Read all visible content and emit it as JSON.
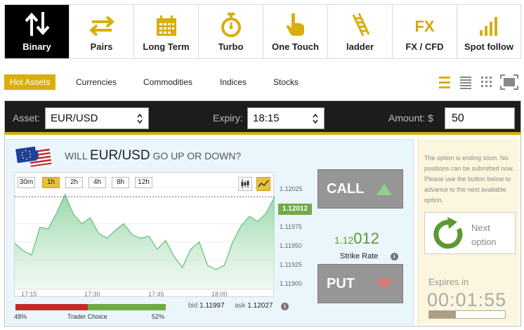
{
  "tabs": [
    {
      "label": "Binary",
      "icon": "up-down-arrows-icon",
      "active": true
    },
    {
      "label": "Pairs",
      "icon": "left-right-arrows-icon"
    },
    {
      "label": "Long Term",
      "icon": "calendar-icon"
    },
    {
      "label": "Turbo",
      "icon": "stopwatch-icon"
    },
    {
      "label": "One Touch",
      "icon": "pointing-hand-icon"
    },
    {
      "label": "ladder",
      "icon": "ladder-icon"
    },
    {
      "label": "FX / CFD",
      "icon": "fx-icon",
      "icon_text": "FX"
    },
    {
      "label": "Spot follow",
      "icon": "bar-chart-icon"
    }
  ],
  "categories": {
    "hot": "Hot Assets",
    "items": [
      "Currencies",
      "Commodities",
      "Indices",
      "Stocks"
    ]
  },
  "view_icons": [
    "list-view-icon",
    "compact-list-icon",
    "grid-view-icon",
    "fullscreen-icon"
  ],
  "trade": {
    "asset_label": "Asset:",
    "asset": "EUR/USD",
    "expiry_label": "Expiry:",
    "expiry": "18:15",
    "amount_label": "Amount: $",
    "amount": "50",
    "question_pre": "WILL",
    "question_asset": "EUR/USD",
    "question_post": "GO UP OR DOWN?",
    "call": "CALL",
    "put": "PUT",
    "strike_prefix": "1.12",
    "strike_main": "012",
    "strike_label": "Strike Rate"
  },
  "chart": {
    "timeframes": [
      "30m",
      "1h",
      "2h",
      "4h",
      "8h",
      "12h"
    ],
    "active_timeframe": "1h",
    "chart_types": [
      "candlestick-icon",
      "line-chart-icon"
    ],
    "active_chart_type": "line-chart-icon",
    "current_price": "1.12012",
    "y_ticks": [
      "1.12025",
      "1.11975",
      "1.11950",
      "1.11925",
      "1.11900"
    ],
    "x_ticks": [
      "17:15",
      "17:30",
      "17:45",
      "18:00"
    ],
    "bid_label": "bid",
    "bid": "1.11997",
    "ask_label": "ask",
    "ask": "1.12027"
  },
  "chart_data": {
    "type": "area",
    "x": [
      "17:10",
      "17:12",
      "17:14",
      "17:16",
      "17:18",
      "17:20",
      "17:22",
      "17:24",
      "17:26",
      "17:28",
      "17:30",
      "17:32",
      "17:34",
      "17:36",
      "17:38",
      "17:40",
      "17:42",
      "17:44",
      "17:46",
      "17:48",
      "17:50",
      "17:52",
      "17:54",
      "17:56",
      "17:58",
      "18:00",
      "18:02",
      "18:04",
      "18:06",
      "18:08",
      "18:10",
      "18:12"
    ],
    "values": [
      1.11948,
      1.11938,
      1.11932,
      1.1197,
      1.11968,
      1.1199,
      1.12015,
      1.11988,
      1.11975,
      1.11983,
      1.11962,
      1.11955,
      1.11966,
      1.11975,
      1.1196,
      1.11955,
      1.11958,
      1.1194,
      1.11952,
      1.1193,
      1.11915,
      1.1194,
      1.1195,
      1.11918,
      1.11912,
      1.11918,
      1.1195,
      1.11972,
      1.11985,
      1.11978,
      1.1199,
      1.12012
    ],
    "ylim": [
      1.11885,
      1.12045
    ],
    "y_ticks": [
      1.12025,
      1.11975,
      1.1195,
      1.11925,
      1.119
    ]
  },
  "trader_choice": {
    "label": "Trader Choice",
    "put_pct": "48%",
    "call_pct": "52%",
    "put_fraction": 0.48
  },
  "side": {
    "message": "The option is ending soon. No positions can be submitted now. Please use the button below to advance to the next available option.",
    "next_label": "Next option",
    "expires_label": "Expires in",
    "expires_time": "00:01:55",
    "expires_progress": 0.35
  },
  "colors": {
    "accent": "#d9ae0f",
    "call_arrow": "#8fd18a",
    "put_arrow": "#e27575",
    "chart_line": "#7cc68c"
  }
}
